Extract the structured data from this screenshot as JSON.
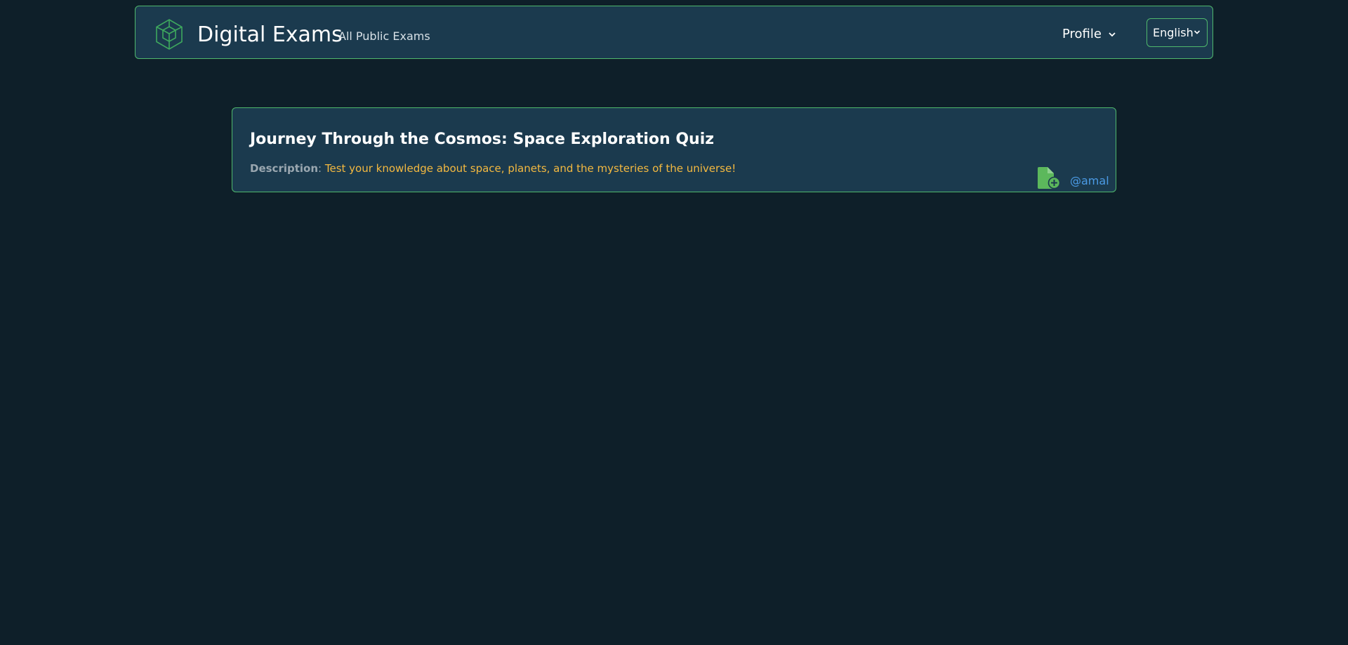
{
  "navbar": {
    "brand": "Digital Exams",
    "links": [
      {
        "label": "All Public Exams"
      }
    ],
    "profile_label": "Profile",
    "language": {
      "selected": "English"
    },
    "icons": {
      "logo": "cube-logo-icon",
      "profile_caret": "chevron-down-icon",
      "language_caret": "chevron-down-icon"
    }
  },
  "exam_card": {
    "title": "Journey Through the Cosmos: Space Exploration Quiz",
    "description_label": "Description",
    "description_separator": ": ",
    "description": "Test your knowledge about space, planets, and the mysteries of the universe!",
    "author": "@amal",
    "icons": {
      "action": "file-add-icon"
    }
  },
  "colors": {
    "background": "#0e1f29",
    "panel": "#1b3a4e",
    "accent": "#4fb86c",
    "description": "#f4b940",
    "link": "#4b9be6"
  }
}
